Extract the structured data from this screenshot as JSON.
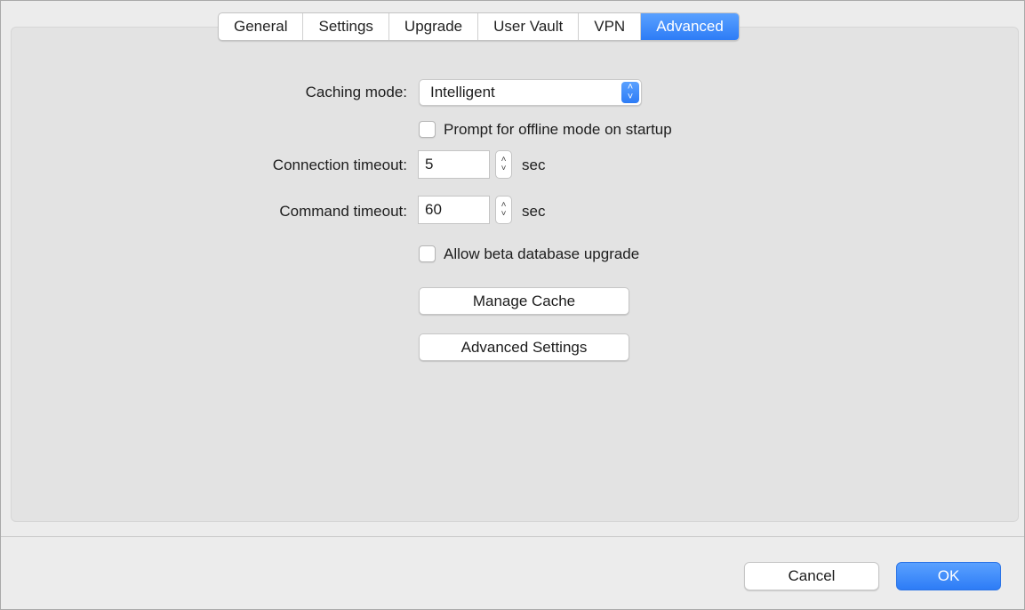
{
  "tabs": [
    {
      "label": "General"
    },
    {
      "label": "Settings"
    },
    {
      "label": "Upgrade"
    },
    {
      "label": "User Vault"
    },
    {
      "label": "VPN"
    },
    {
      "label": "Advanced"
    }
  ],
  "active_tab": "Advanced",
  "accent_color": "#2d7cf6",
  "caching": {
    "label": "Caching mode:",
    "value": "Intelligent",
    "offline_prompt_label": "Prompt for offline mode on startup",
    "offline_prompt_checked": false
  },
  "connection_timeout": {
    "label": "Connection timeout:",
    "value": "5",
    "unit": "sec"
  },
  "command_timeout": {
    "label": "Command timeout:",
    "value": "60",
    "unit": "sec"
  },
  "beta_upgrade": {
    "label": "Allow beta database upgrade",
    "checked": false
  },
  "buttons": {
    "manage_cache": "Manage Cache",
    "advanced_settings": "Advanced Settings",
    "cancel": "Cancel",
    "ok": "OK"
  }
}
